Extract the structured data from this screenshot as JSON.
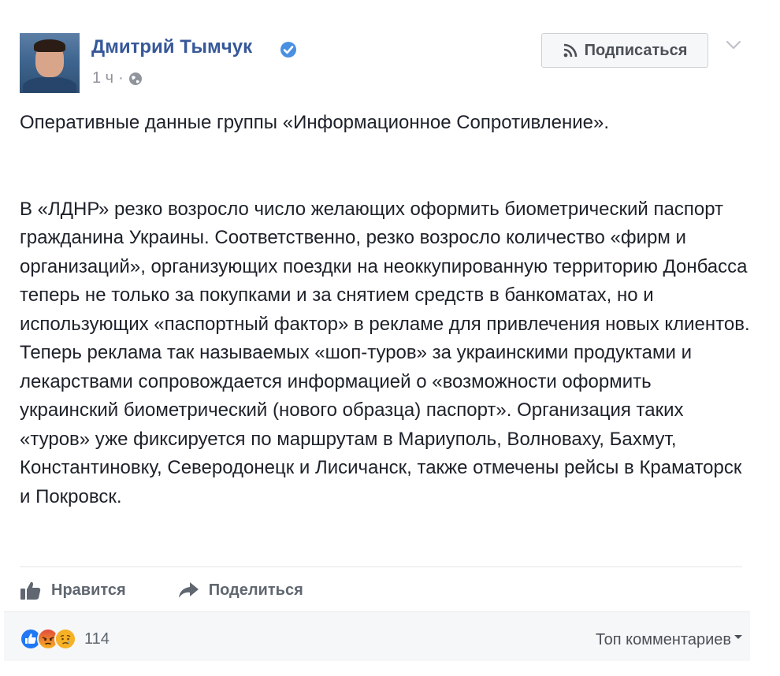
{
  "post": {
    "author": "Дмитрий Тымчук",
    "timestamp": "1 ч",
    "separator": "·",
    "privacy_icon": "globe-icon",
    "verified_icon": "verified-badge-icon",
    "subscribe_label": "Подписаться",
    "subscribe_icon": "rss-icon",
    "menu_icon": "chevron-down-icon",
    "paragraph_1": "Оперативные данные группы «Информационное Сопротивление».",
    "paragraph_2": "В «ЛДНР» резко возросло число желающих оформить биометрический паспорт гражданина Украины. Соответственно, резко возросло количество «фирм и организаций», организующих поездки на неоккупированную территорию Донбасса теперь не только за покупками и за снятием средств в банкоматах, но и использующих «паспортный фактор» в рекламе для привлечения новых клиентов. Теперь реклама так называемых «шоп-туров» за украинскими продуктами и лекарствами сопровождается информацией о «возможности оформить украинский биометрический (нового образца) паспорт». Организация таких «туров» уже фиксируется по маршрутам в Мариуполь, Волноваху, Бахмут, Константиновку, Северодонецк и Лисичанск, также отмечены рейсы в Краматорск и Покровск."
  },
  "actions": {
    "like_label": "Нравится",
    "like_icon": "thumbs-up-icon",
    "share_label": "Поделиться",
    "share_icon": "share-arrow-icon"
  },
  "footer": {
    "reactions": [
      "like-reaction-icon",
      "angry-reaction-icon",
      "sad-reaction-icon"
    ],
    "reaction_count": "114",
    "top_comments_label": "Топ комментариев"
  },
  "colors": {
    "link_blue": "#365899",
    "text": "#1d2129",
    "muted": "#90949c",
    "like_blue": "#2078f4",
    "angry": "#e9710f",
    "sad": "#f7b125"
  }
}
